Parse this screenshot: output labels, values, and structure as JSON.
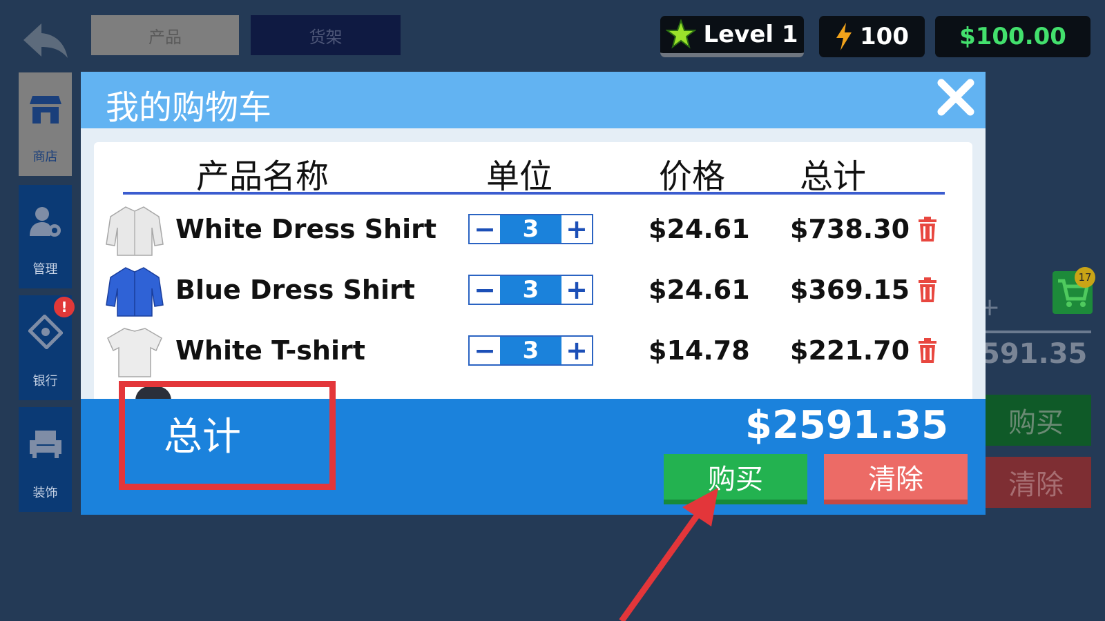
{
  "top_tabs": {
    "products": "产品",
    "shelves": "货架"
  },
  "hud": {
    "level": "Level 1",
    "energy": "100",
    "money": "$100.00"
  },
  "sidebar": {
    "store": "商店",
    "manage": "管理",
    "bank": "银行",
    "decor": "装饰"
  },
  "background": {
    "cart_count": "17",
    "plus": "+",
    "total": "591.35",
    "buy": "购买",
    "clear": "清除"
  },
  "cart": {
    "title": "我的购物车",
    "columns": {
      "name": "产品名称",
      "unit": "单位",
      "price": "价格",
      "total": "总计"
    },
    "items": [
      {
        "name": "White Dress Shirt",
        "qty": "3",
        "price": "$24.61",
        "total": "$738.30"
      },
      {
        "name": "Blue Dress Shirt",
        "qty": "3",
        "price": "$24.61",
        "total": "$369.15"
      },
      {
        "name": "White T-shirt",
        "qty": "3",
        "price": "$14.78",
        "total": "$221.70"
      }
    ],
    "minus": "−",
    "plus": "+",
    "footer": {
      "total_label": "总计",
      "total_value": "$2591.35",
      "buy": "购买",
      "clear": "清除"
    }
  },
  "colors": {
    "accent_green": "#23b250",
    "accent_red": "#ec6b66",
    "header_blue": "#62b3f2",
    "footer_blue": "#1b82dc",
    "annotation_red": "#e3363a"
  }
}
